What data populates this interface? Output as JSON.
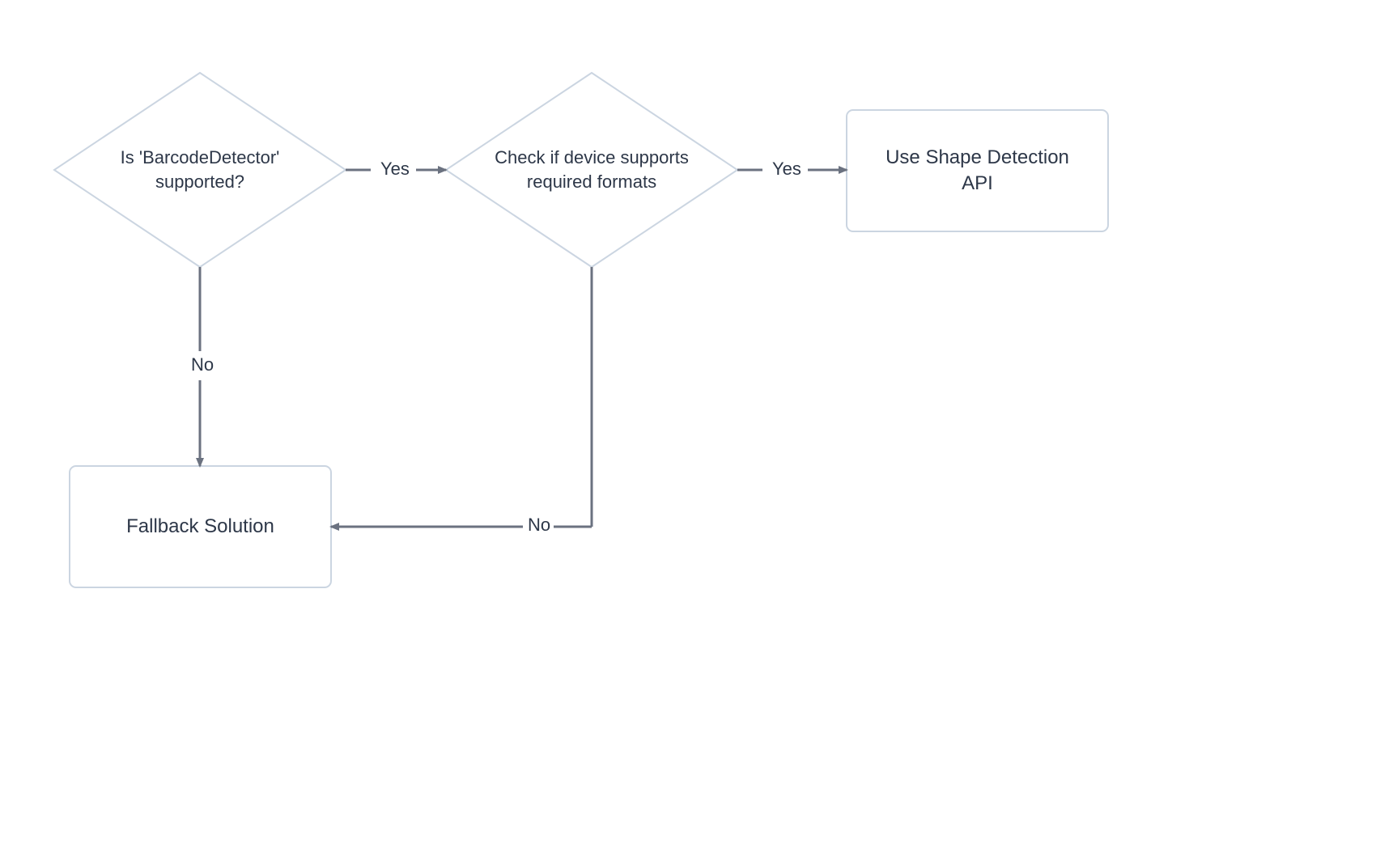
{
  "diagram": {
    "nodes": {
      "decision1": {
        "line1": "Is 'BarcodeDetector'",
        "line2": "supported?"
      },
      "decision2": {
        "line1": "Check if device supports",
        "line2": "required formats"
      },
      "process1": {
        "line1": "Use Shape Detection",
        "line2": "API"
      },
      "process2": {
        "text": "Fallback Solution"
      }
    },
    "edges": {
      "yes1": "Yes",
      "yes2": "Yes",
      "no1": "No",
      "no2": "No"
    },
    "colors": {
      "nodeBorder": "#cbd5e1",
      "edge": "#6b7280",
      "text": "#2d3748"
    }
  }
}
